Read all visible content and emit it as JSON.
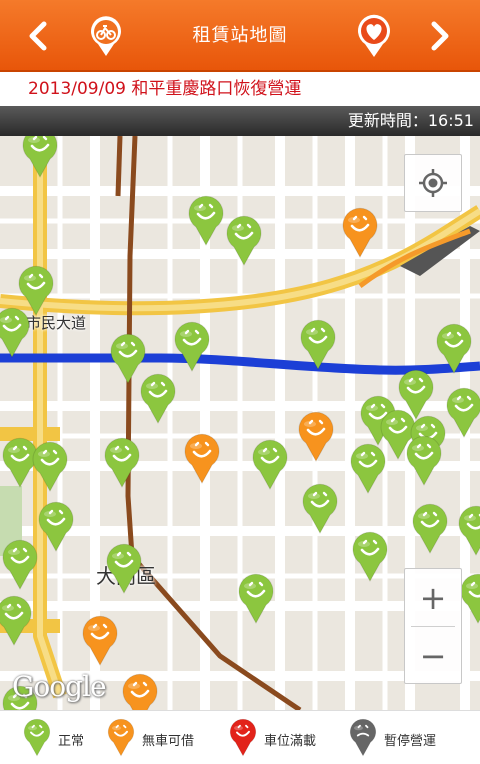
{
  "header": {
    "title": "租賃站地圖",
    "back_icon": "chevron-left-icon",
    "forward_icon": "chevron-right-icon",
    "logo_icon": "bike-logo-icon",
    "favorite_icon": "heart-icon",
    "color": "#ef6a1c"
  },
  "ticker": {
    "text": "2013/09/09 和平重慶路口恢復營運"
  },
  "update_bar": {
    "text": "更新時間：16:51"
  },
  "map": {
    "labels": {
      "street": "市民大道",
      "district": "大同區"
    },
    "attribution": "Google",
    "locate_icon": "my-location-icon",
    "zoom_in": "+",
    "zoom_out": "−"
  },
  "legend": {
    "items": [
      {
        "label": "正常",
        "status": "normal",
        "color": "#8cc63f"
      },
      {
        "label": "無車可借",
        "status": "no-bike",
        "color": "#f7931e"
      },
      {
        "label": "車位滿載",
        "status": "full",
        "color": "#e2231a"
      },
      {
        "label": "暫停營運",
        "status": "suspended",
        "color": "#666666"
      }
    ]
  }
}
